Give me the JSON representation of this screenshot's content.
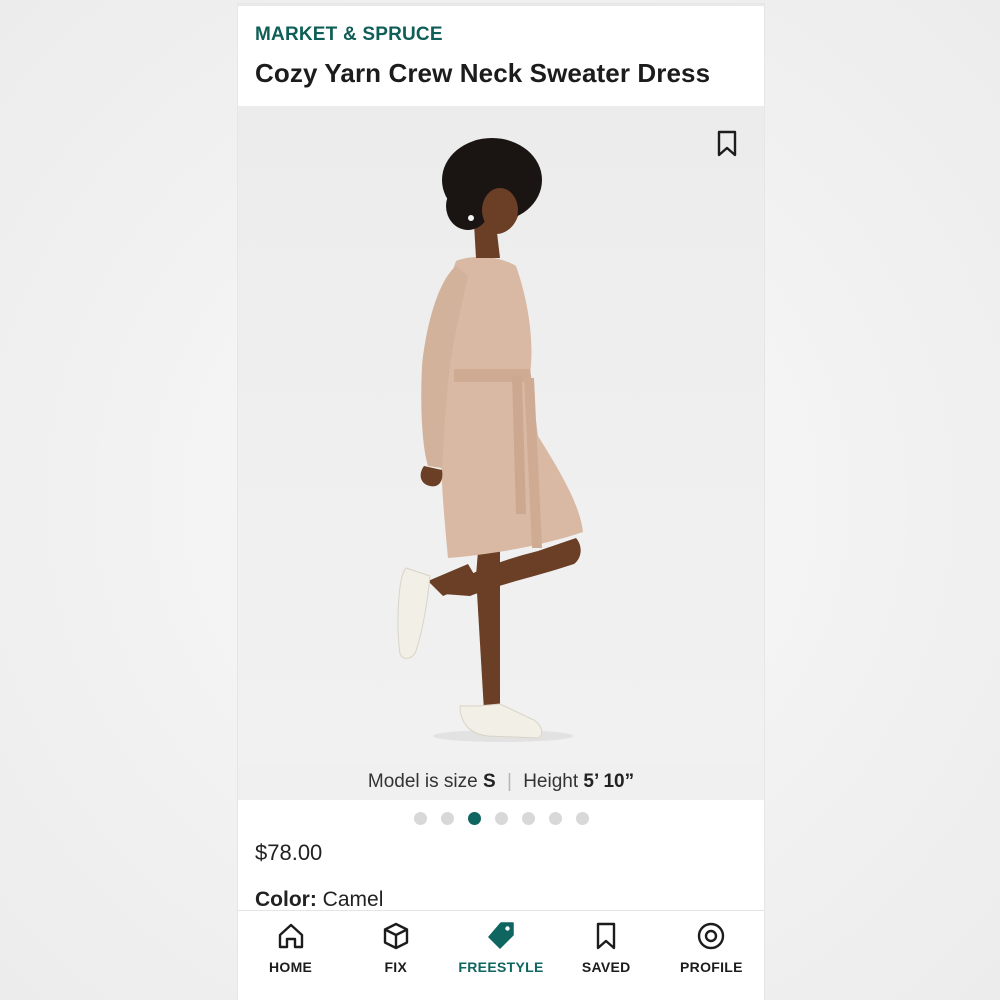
{
  "product": {
    "brand": "MARKET & SPRUCE",
    "title": "Cozy Yarn Crew Neck Sweater Dress",
    "price": "$78.00",
    "color_label": "Color:",
    "color_value": "Camel"
  },
  "image": {
    "description_icon": "bookmark-icon",
    "caption_prefix": "Model is size",
    "caption_size": "S",
    "caption_separator": "|",
    "caption_height_label": "Height",
    "caption_height_value": "5’ 10”",
    "carousel_count": 7,
    "carousel_active_index": 2
  },
  "tabbar": {
    "items": [
      {
        "label": "HOME",
        "icon": "home-icon",
        "active": false
      },
      {
        "label": "FIX",
        "icon": "box-icon",
        "active": false
      },
      {
        "label": "FREESTYLE",
        "icon": "tag-icon",
        "active": true
      },
      {
        "label": "SAVED",
        "icon": "bookmark-icon",
        "active": false
      },
      {
        "label": "PROFILE",
        "icon": "profile-icon",
        "active": false
      }
    ]
  },
  "colors": {
    "brand": "#0f5e57",
    "accent": "#0f6560",
    "dress": "#d9b9a3",
    "skin": "#6b3f26"
  }
}
